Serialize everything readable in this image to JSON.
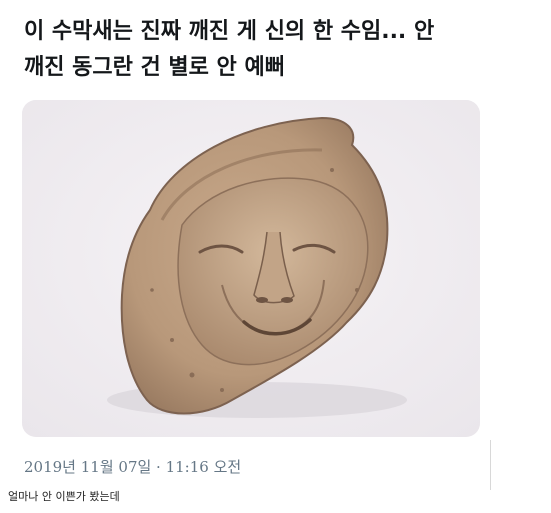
{
  "tweet": {
    "text": "이 수막새는 진짜 깨진 게 신의 한 수임... 안\n깨진 동그란 건 별로 안 예뻐",
    "timestamp": "2019년 11월 07일 · 11:16 오전"
  },
  "comment": {
    "text": "얼마나 안 이쁜가 봤는데"
  }
}
